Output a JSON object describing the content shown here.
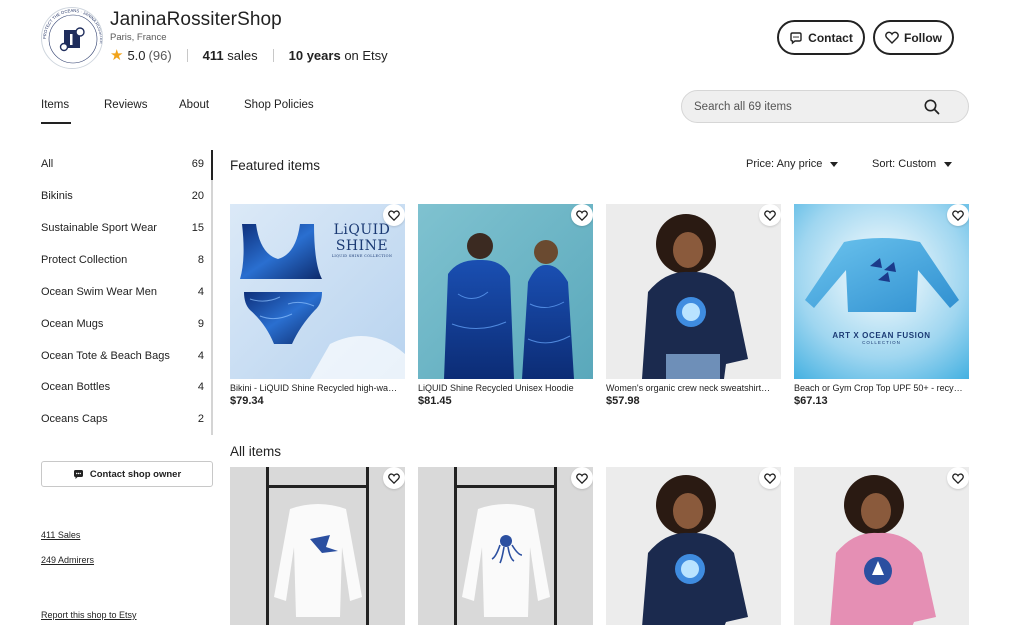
{
  "shop": {
    "name": "JaninaRossiterShop",
    "location": "Paris, France",
    "rating": "5.0",
    "review_count": "(96)",
    "sales_num": "411",
    "sales_word": "sales",
    "years_num": "10 years",
    "years_suffix": "on Etsy",
    "logo_ring_text": "PROTECT THE OCEANS · JANINA ROSSITER"
  },
  "header_buttons": {
    "contact": "Contact",
    "follow": "Follow"
  },
  "tabs": [
    {
      "label": "Items",
      "active": true
    },
    {
      "label": "Reviews",
      "active": false
    },
    {
      "label": "About",
      "active": false
    },
    {
      "label": "Shop Policies",
      "active": false
    }
  ],
  "search": {
    "placeholder": "Search all 69 items"
  },
  "sidebar": {
    "items": [
      {
        "label": "All",
        "count": "69"
      },
      {
        "label": "Bikinis",
        "count": "20"
      },
      {
        "label": "Sustainable Sport Wear",
        "count": "15"
      },
      {
        "label": "Protect Collection",
        "count": "8"
      },
      {
        "label": "Ocean Swim Wear Men",
        "count": "4"
      },
      {
        "label": "Ocean Mugs",
        "count": "9"
      },
      {
        "label": "Ocean Tote & Beach Bags",
        "count": "4"
      },
      {
        "label": "Ocean Bottles",
        "count": "4"
      },
      {
        "label": "Oceans Caps",
        "count": "2"
      }
    ],
    "contact_owner": "Contact shop owner",
    "sales_link": "411 Sales",
    "admirers_link": "249 Admirers",
    "report_link": "Report this shop to Etsy"
  },
  "featured": {
    "title": "Featured items",
    "price_filter": "Price: Any price",
    "sort": "Sort: Custom",
    "items": [
      {
        "title": "Bikini - LiQUID Shine Recycled high-wa…",
        "price": "$79.34",
        "overlay_line1": "LiQUID",
        "overlay_line2": "SHINE",
        "overlay_line3": "LIQUID SHINE COLLECTION"
      },
      {
        "title": "LiQUID Shine Recycled Unisex Hoodie",
        "price": "$81.45"
      },
      {
        "title": "Women's organic crew neck sweatshirt…",
        "price": "$57.98"
      },
      {
        "title": "Beach or Gym Crop Top UPF 50+ - recy…",
        "price": "$67.13",
        "overlay_line1": "ART X OCEAN FUSION",
        "overlay_line2": "COLLECTION"
      }
    ]
  },
  "all_items": {
    "title": "All items"
  },
  "colors": {
    "accent_star": "#f1a31a",
    "text": "#222222",
    "ocean_blue": "#1e4fa8",
    "navy": "#1b2a4e",
    "pink": "#e58fb4"
  }
}
